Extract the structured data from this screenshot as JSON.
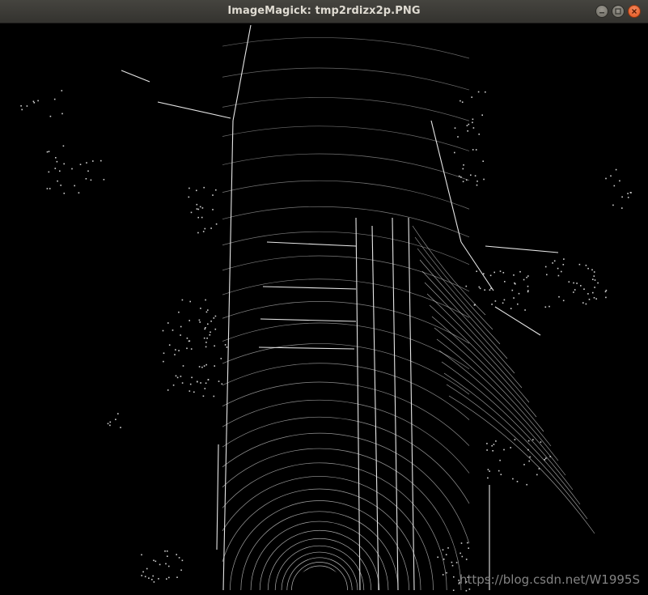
{
  "window": {
    "title": "ImageMagick: tmp2rdizx2p.PNG"
  },
  "controls": {
    "minimize_icon": "minimize-icon",
    "maximize_icon": "maximize-icon",
    "close_icon": "close-icon"
  },
  "image": {
    "description_colors": {
      "background": "#000000",
      "points": "#ffffff"
    }
  },
  "watermark": {
    "text": "https://blog.csdn.net/W1995S"
  }
}
